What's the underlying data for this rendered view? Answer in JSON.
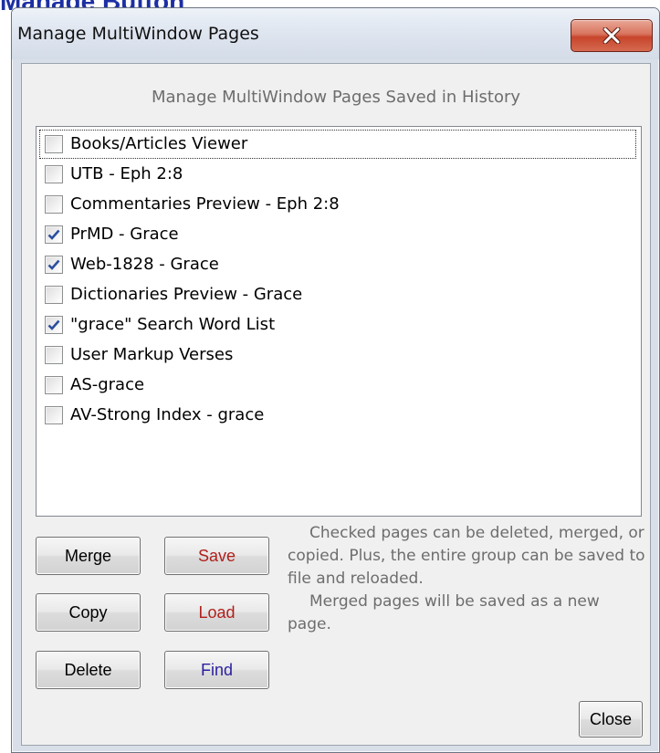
{
  "page_heading": "Manage Button",
  "window": {
    "title": "Manage MultiWindow Pages",
    "close_icon": "close-x-icon"
  },
  "dialog": {
    "subtitle": "Manage MultiWindow Pages Saved in History",
    "pages": [
      {
        "label": "Books/Articles Viewer",
        "checked": false
      },
      {
        "label": "UTB - Eph 2:8",
        "checked": false
      },
      {
        "label": "Commentaries Preview - Eph 2:8",
        "checked": false
      },
      {
        "label": "PrMD - Grace",
        "checked": true
      },
      {
        "label": "Web-1828 - Grace",
        "checked": true
      },
      {
        "label": "Dictionaries Preview - Grace",
        "checked": false
      },
      {
        "label": "\"grace\" Search Word List",
        "checked": true
      },
      {
        "label": "User Markup Verses",
        "checked": false
      },
      {
        "label": "AS-grace",
        "checked": false
      },
      {
        "label": "AV-Strong Index - grace",
        "checked": false
      }
    ],
    "buttons": {
      "merge": "Merge",
      "save": "Save",
      "copy": "Copy",
      "load": "Load",
      "delete": "Delete",
      "find": "Find",
      "close": "Close"
    },
    "help_paragraph_1": "Checked pages can be deleted, merged, or copied. Plus, the entire group can be saved to file and reloaded.",
    "help_paragraph_2": "Merged pages will be saved as a new page."
  },
  "colors": {
    "heading": "#1c2fa3",
    "save_text": "#b0201c",
    "load_text": "#b0201c",
    "find_text": "#2a1fa0",
    "help_text": "#6d6d6d"
  }
}
